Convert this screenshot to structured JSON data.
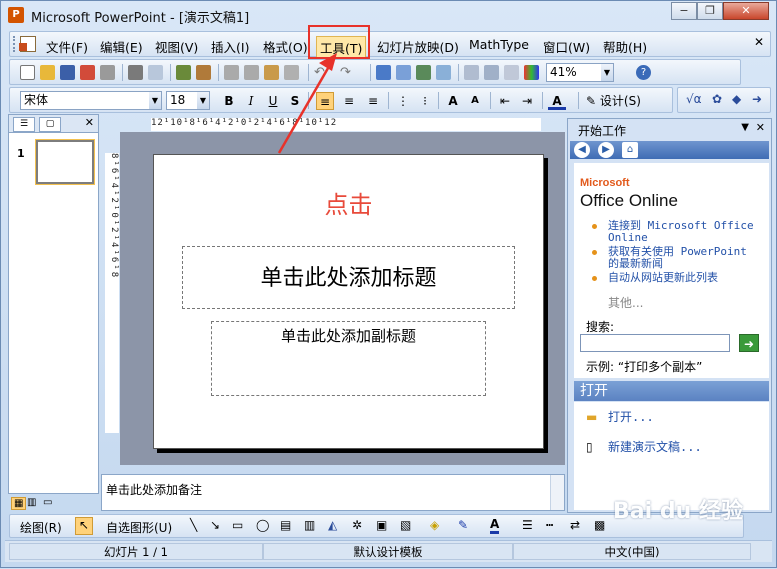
{
  "window": {
    "title": "Microsoft PowerPoint - [演示文稿1]",
    "min_glyph": "−",
    "max_glyph": "❐",
    "close_glyph": "✕"
  },
  "menu": {
    "items": [
      "文件(F)",
      "编辑(E)",
      "视图(V)",
      "插入(I)",
      "格式(O)",
      "工具(T)",
      "幻灯片放映(D)",
      "MathType",
      "窗口(W)",
      "帮助(H)"
    ]
  },
  "standard_toolbar": {
    "zoom": "41%"
  },
  "format_toolbar": {
    "font": "宋体",
    "size": "18",
    "bold": "B",
    "italic": "I",
    "underline": "U",
    "shadow": "S",
    "font_grow": "A",
    "font_shrink": "A",
    "font_color": "A",
    "design_label": "设计(S)"
  },
  "slides_panel": {
    "slide_number": "1"
  },
  "slide": {
    "annotation": "点击",
    "title_placeholder": "单击此处添加标题",
    "subtitle_placeholder": "单击此处添加副标题"
  },
  "notes": {
    "placeholder": "单击此处添加备注"
  },
  "rulers": {
    "horizontal": "12¹10¹8¹6¹4¹2¹0¹2¹4¹6¹8¹10¹12",
    "vertical": "8¹6¹4¹2¹0¹2¹4¹6¹8"
  },
  "task_pane": {
    "title": "开始工作",
    "logo_prefix": "Microsoft",
    "logo_text": "Office Online",
    "links": [
      "连接到 Microsoft Office Online",
      "获取有关使用 PowerPoint 的最新新闻",
      "自动从网站更新此列表"
    ],
    "more": "其他...",
    "search_label": "搜索:",
    "example": "示例: “打印多个副本”",
    "open_section": "打开",
    "open_link": "打开...",
    "new_link": "新建演示文稿..."
  },
  "drawing_toolbar": {
    "draw_label": "绘图(R)",
    "autoshape_label": "自选图形(U)"
  },
  "status_bar": {
    "slide_info": "幻灯片 1 / 1",
    "template": "默认设计模板",
    "language": "中文(中国)"
  },
  "watermark": {
    "text": "Bai du 经验"
  },
  "colors": {
    "highlight": "#e8322a",
    "annotation_text": "#e84a3a",
    "link": "#2351a8"
  }
}
